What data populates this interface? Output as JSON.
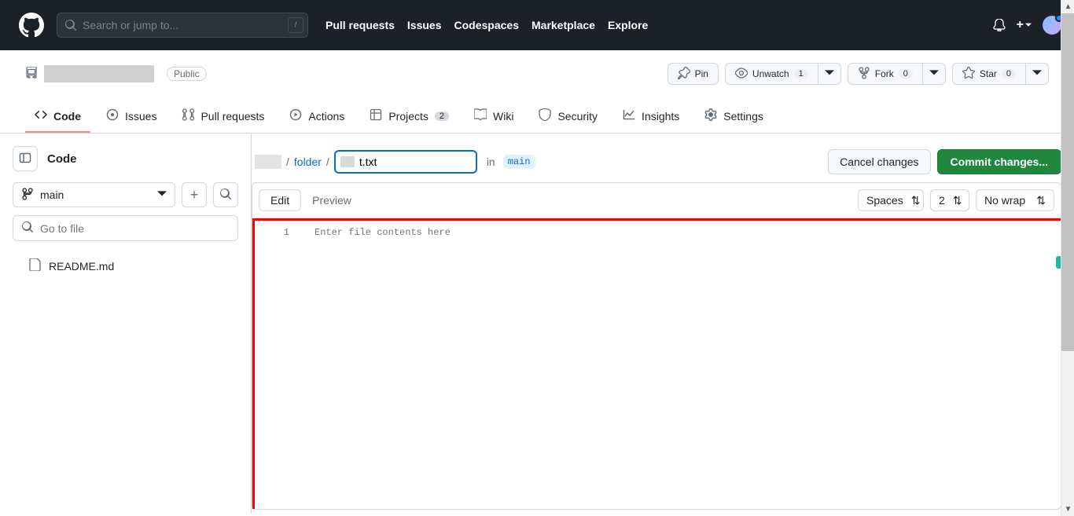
{
  "header": {
    "search_placeholder": "Search or jump to...",
    "slash_hint": "/",
    "nav": [
      "Pull requests",
      "Issues",
      "Codespaces",
      "Marketplace",
      "Explore"
    ]
  },
  "repo": {
    "visibility": "Public",
    "actions": {
      "pin": "Pin",
      "watch": "Unwatch",
      "watch_count": "1",
      "fork": "Fork",
      "fork_count": "0",
      "star": "Star",
      "star_count": "0"
    },
    "tabs": [
      {
        "label": "Code",
        "icon": "code",
        "active": true
      },
      {
        "label": "Issues",
        "icon": "issue"
      },
      {
        "label": "Pull requests",
        "icon": "pr"
      },
      {
        "label": "Actions",
        "icon": "play"
      },
      {
        "label": "Projects",
        "icon": "table",
        "count": "2"
      },
      {
        "label": "Wiki",
        "icon": "book"
      },
      {
        "label": "Security",
        "icon": "shield"
      },
      {
        "label": "Insights",
        "icon": "graph"
      },
      {
        "label": "Settings",
        "icon": "gear"
      }
    ]
  },
  "sidebar": {
    "title": "Code",
    "branch": "main",
    "file_search_placeholder": "Go to file",
    "tree": [
      "README.md"
    ]
  },
  "editor": {
    "crumb_folder": "folder",
    "filename": "t.txt",
    "in_label": "in",
    "branch_pill": "main",
    "cancel": "Cancel changes",
    "commit": "Commit changes...",
    "tabs": {
      "edit": "Edit",
      "preview": "Preview"
    },
    "settings": {
      "indent": "Spaces",
      "size": "2",
      "wrap": "No wrap"
    },
    "gutter_first": "1",
    "placeholder": "Enter file contents here"
  }
}
